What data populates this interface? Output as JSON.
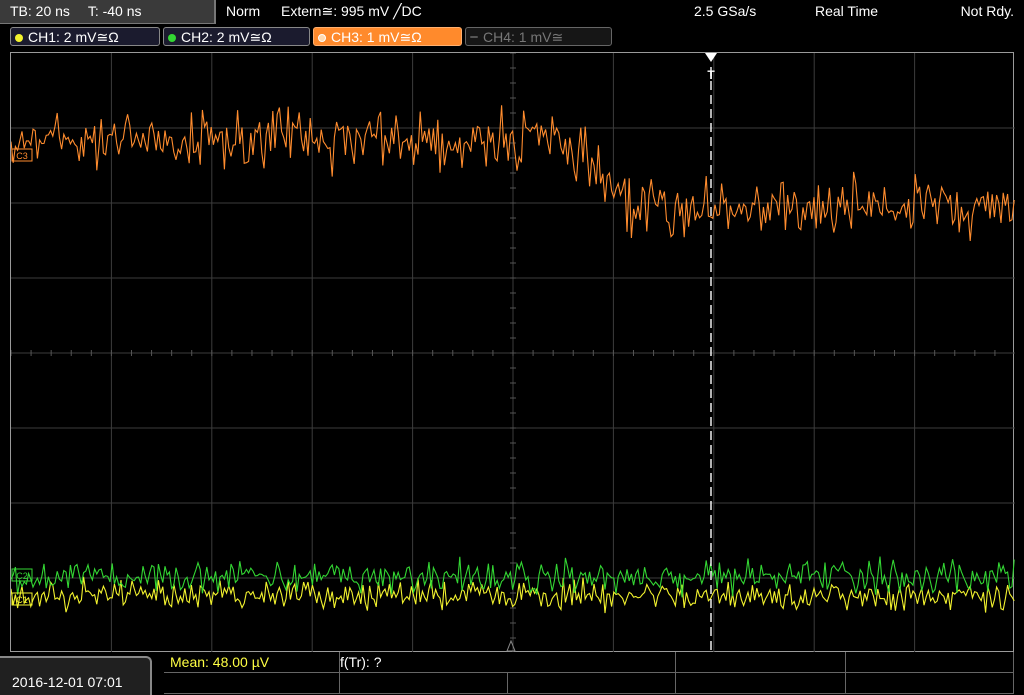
{
  "topbar": {
    "timebase": "TB: 20 ns",
    "trigger_offset": "T: -40 ns",
    "mode": "Norm",
    "trigger_source": "Extern≅: 995 mV ╱DC",
    "sample_rate": "2.5 GSa/s",
    "acquisition": "Real Time",
    "status": "Not Rdy."
  },
  "channels": [
    {
      "label": "CH1: 2 mV≅Ω",
      "color": "#f2f22e",
      "marker": "C1",
      "active": true
    },
    {
      "label": "CH2: 2 mV≅Ω",
      "color": "#33d633",
      "marker": "C2",
      "active": true
    },
    {
      "label": "CH3: 1 mV≅Ω",
      "color": "#ff8c2e",
      "marker": "C3",
      "active": true
    },
    {
      "label": "CH4: 1 mV≅",
      "color": "#777777",
      "marker": "",
      "active": false
    }
  ],
  "trigger_marker": "T",
  "measurements": {
    "mean": "Mean: 48.00 µV",
    "f_tr": "f(Tr): ?"
  },
  "datetime": "2016-12-01 07:01",
  "icons": {
    "trigger": "trigger-position-arrow-icon",
    "channel_dot": "channel-indicator-dot-icon"
  }
}
